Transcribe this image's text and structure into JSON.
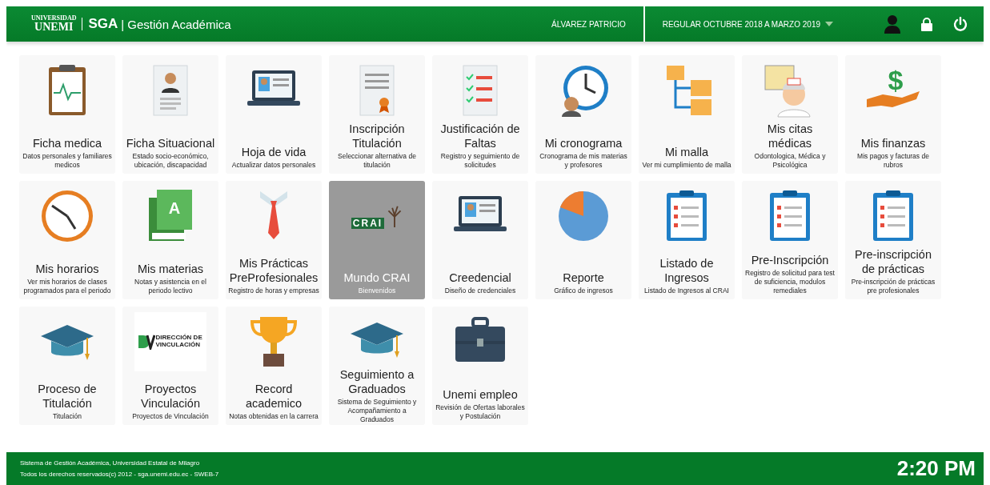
{
  "header": {
    "logo": {
      "top": "UNIVERSIDAD",
      "main": "UNEMI"
    },
    "app": "SGA",
    "title": "| Gestión Académica",
    "user": "ÁLVAREZ PATRICIO",
    "period": "REGULAR OCTUBRE 2018 A MARZO 2019"
  },
  "cards": [
    {
      "kind": "clipboard",
      "title": "Ficha medica",
      "desc": "Datos personales y familiares medicos",
      "selected": false
    },
    {
      "kind": "resume",
      "title": "Ficha Situacional",
      "desc": "Estado socio-económico, ubicación, discapacidad",
      "selected": false
    },
    {
      "kind": "laptop",
      "title": "Hoja de vida",
      "desc": "Actualizar datos personales",
      "selected": false
    },
    {
      "kind": "certificate",
      "title": "Inscripción Titulación",
      "desc": "Seleccionar alternativa de titulación",
      "selected": false
    },
    {
      "kind": "checklist",
      "title": "Justificación de Faltas",
      "desc": "Registro y seguimiento de solicitudes",
      "selected": false
    },
    {
      "kind": "clock",
      "title": "Mi cronograma",
      "desc": "Cronograma de mis materias y profesores",
      "selected": false
    },
    {
      "kind": "flowchart",
      "title": "Mi malla",
      "desc": "Ver mi cumplimiento de malla",
      "selected": false
    },
    {
      "kind": "nurse",
      "title": "Mis citas médicas",
      "desc": "Odontologica, Médica y Psicológica",
      "selected": false
    },
    {
      "kind": "money",
      "glyph": "$",
      "title": "Mis finanzas",
      "desc": "Mis pagos y facturas de rubros",
      "selected": false
    },
    {
      "kind": "wallclock",
      "title": "Mis horarios",
      "desc": "Ver mis horarios de clases programados para el periodo",
      "selected": false
    },
    {
      "kind": "book",
      "glyph": "A",
      "title": "Mis materias",
      "desc": "Notas y asistencia en el periodo lectivo",
      "selected": false
    },
    {
      "kind": "tie",
      "title": "Mis Prácticas PreProfesionales",
      "desc": "Registro de horas y empresas",
      "selected": false
    },
    {
      "kind": "crai",
      "logo_text": "CRAI",
      "title": "Mundo CRAI",
      "desc": "Bienvenidos",
      "selected": true
    },
    {
      "kind": "laptop",
      "title": "Creedencial",
      "desc": "Diseño de credenciales",
      "selected": false
    },
    {
      "kind": "pie",
      "title": "Reporte",
      "desc": "Gráfico de ingresos",
      "selected": false
    },
    {
      "kind": "form",
      "title": "Listado de Ingresos",
      "desc": "Listado de Ingresos al CRAI",
      "selected": false
    },
    {
      "kind": "form",
      "title": "Pre-Inscripción",
      "desc": "Registro de solicitud para test de suficiencia, modulos remediales",
      "selected": false
    },
    {
      "kind": "form",
      "title": "Pre-inscripción de prácticas",
      "desc": "Pre-inscripción de prácticas pre profesionales",
      "selected": false
    },
    {
      "kind": "cap",
      "title": "Proceso de Titulación",
      "desc": "Titulación",
      "selected": false
    },
    {
      "kind": "vinculacion",
      "logo_text": "DIRECCIÓN DE VINCULACIÓN",
      "title": "Proyectos Vinculación",
      "desc": "Proyectos de Vinculación",
      "selected": false
    },
    {
      "kind": "trophy",
      "title": "Record academico",
      "desc": "Notas obtenidas en la carrera",
      "selected": false
    },
    {
      "kind": "cap",
      "title": "Seguimiento a Graduados",
      "desc": "Sistema de Seguimiento y Acompañamiento a Graduados",
      "selected": false
    },
    {
      "kind": "briefcase",
      "title": "Unemi empleo",
      "desc": "Revisión de Ofertas laborales y Postulación",
      "selected": false
    }
  ],
  "footer": {
    "lines": [
      "Sistema de Gestión Académica, Universidad Estatal de Milagro",
      "Todos los derechos reservados(c) 2012 - sga.unemi.edu.ec - SWEB-7"
    ],
    "time": "2:20 PM"
  }
}
